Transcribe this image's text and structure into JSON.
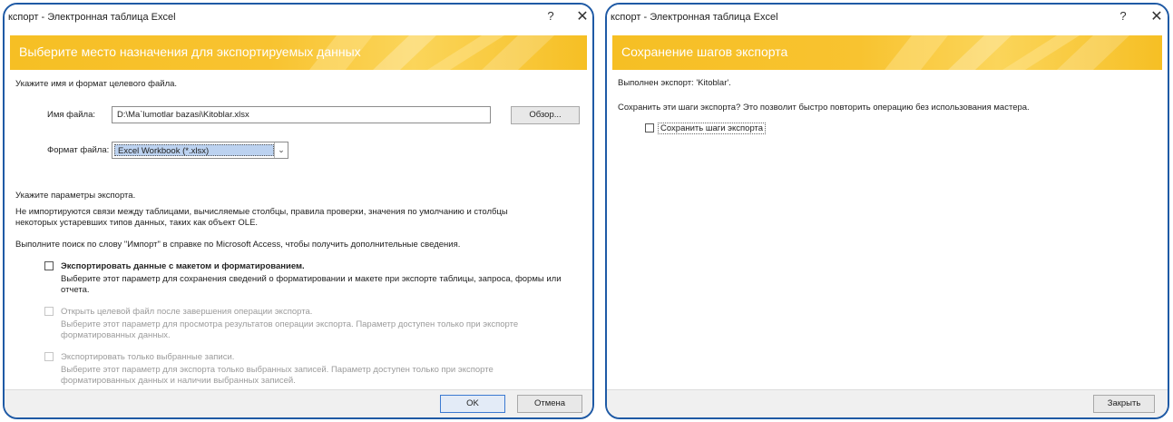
{
  "dialog1": {
    "title": "кспорт - Электронная таблица Excel",
    "help_glyph": "?",
    "close_glyph": "✕",
    "header": "Выберите место назначения для экспортируемых данных",
    "instruction": "Укажите имя и формат целевого файла.",
    "filename_label": "Имя файла:",
    "filename_value": "D:\\Ma`lumotlar bazasi\\Kitoblar.xlsx",
    "browse_label": "Обзор...",
    "format_label": "Формат файла:",
    "format_value": "Excel Workbook (*.xlsx)",
    "options_heading": "Укажите параметры экспорта.",
    "note_line1": "Не импортируются связи между таблицами, вычисляемые столбцы, правила проверки, значения по умолчанию и столбцы",
    "note_line2": "некоторых устаревших типов данных, таких как объект OLE.",
    "search_note": "Выполните поиск по слову \"Импорт\" в справке по Microsoft Access, чтобы получить дополнительные сведения.",
    "option1": {
      "label": "Экспортировать данные с макетом и форматированием.",
      "desc1": "Выберите этот параметр для сохранения сведений о форматировании и макете при экспорте таблицы, запроса, формы или",
      "desc2": "отчета."
    },
    "option2": {
      "label": "Открыть целевой файл после завершения операции экспорта.",
      "desc1": "Выберите этот параметр для просмотра результатов операции экспорта. Параметр доступен только при экспорте",
      "desc2": "форматированных данных."
    },
    "option3": {
      "label": "Экспортировать только выбранные записи.",
      "desc1": "Выберите этот параметр для экспорта только выбранных записей. Параметр доступен только при экспорте",
      "desc2": "форматированных данных и наличии выбранных записей."
    },
    "ok_label": "OK",
    "cancel_label": "Отмена"
  },
  "dialog2": {
    "title": "кспорт - Электронная таблица Excel",
    "help_glyph": "?",
    "close_glyph": "✕",
    "header": "Сохранение шагов экспорта",
    "done_text": "Выполнен экспорт: 'Kitoblar'.",
    "question": "Сохранить эти шаги экспорта? Это позволит быстро повторить операцию без использования мастера.",
    "save_steps_label": "Сохранить шаги экспорта",
    "close_label": "Закрыть"
  },
  "colors": {
    "header_gold": "#f6bf24",
    "frame_blue": "#1f5aa5",
    "selection": "#bcd2f0"
  }
}
